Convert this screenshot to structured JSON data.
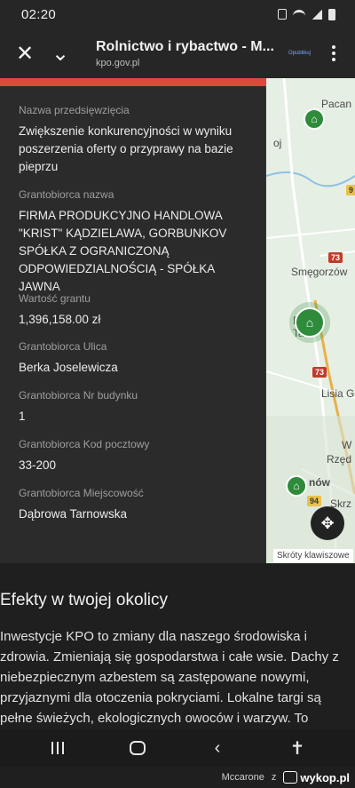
{
  "status_bar": {
    "time": "02:20",
    "icons": [
      "notification-icon",
      "wifi-icon",
      "signal-icon",
      "battery-icon"
    ]
  },
  "toolbar": {
    "close_icon": "✕",
    "chevron_icon": "⌄",
    "title": "Rolnictwo i rybactwo - M...",
    "url": "kpo.gov.pl",
    "publish_label": "Opublikuj"
  },
  "panel": {
    "fields": [
      {
        "label": "Nazwa przedsięwzięcia",
        "value": "Zwiększenie konkurencyjności w wyniku poszerzenia oferty o przyprawy na bazie pieprzu"
      },
      {
        "label": "Grantobiorca nazwa",
        "value": "FIRMA PRODUKCYJNO HANDLOWA \"KRIST\" KĄDZIELAWA, GORBUNKOV SPÓŁKA Z OGRANICZONĄ ODPOWIEDZIALNOŚCIĄ - SPÓŁKA JAWNA"
      },
      {
        "label": "Wartość grantu",
        "value": "1,396,158.00 zł"
      },
      {
        "label": "Grantobiorca Ulica",
        "value": "Berka Joselewicza"
      },
      {
        "label": "Grantobiorca Nr budynku",
        "value": "1"
      },
      {
        "label": "Grantobiorca Kod pocztowy",
        "value": "33-200"
      },
      {
        "label": "Grantobiorca Miejscowość",
        "value": "Dąbrowa Tarnowska"
      }
    ]
  },
  "map": {
    "labels": {
      "pacan": "Pacan",
      "stopnica": "oj",
      "smegorzow": "Smęgorzów",
      "dabrowa": "Dą",
      "dabrowa2": "Ta",
      "lisia": "Lisia G",
      "w": "W",
      "rzed": "Rzęd",
      "nów": "nów",
      "skrz": "Skrz"
    },
    "road_badges": {
      "r73a": "73",
      "r73b": "73",
      "r94": "94",
      "r9": "9"
    },
    "fab_icon": "✥",
    "attribution": "Skróty klawiszowe"
  },
  "section": {
    "title": "Efekty w twojej okolicy",
    "text": "Inwestycje KPO to zmiany dla naszego środowiska i zdrowia. Zmieniają się gospodarstwa i całe wsie. Dachy z niebezpiecznym azbestem są zastępowane nowymi, przyjaznymi dla otoczenia pokryciami. Lokalne targi są pełne świeżych, ekologicznych owoców i warzyw. To"
  },
  "navbar": {
    "back_icon": "‹",
    "accessibility_icon": "✝"
  },
  "footer": {
    "user": "Mccarone",
    "connector": "z",
    "brand": "wykop.pl"
  },
  "colors": {
    "panel_accent": "#d94a3a",
    "map_pin": "#2e8b3a",
    "background": "#1f1f1f"
  }
}
